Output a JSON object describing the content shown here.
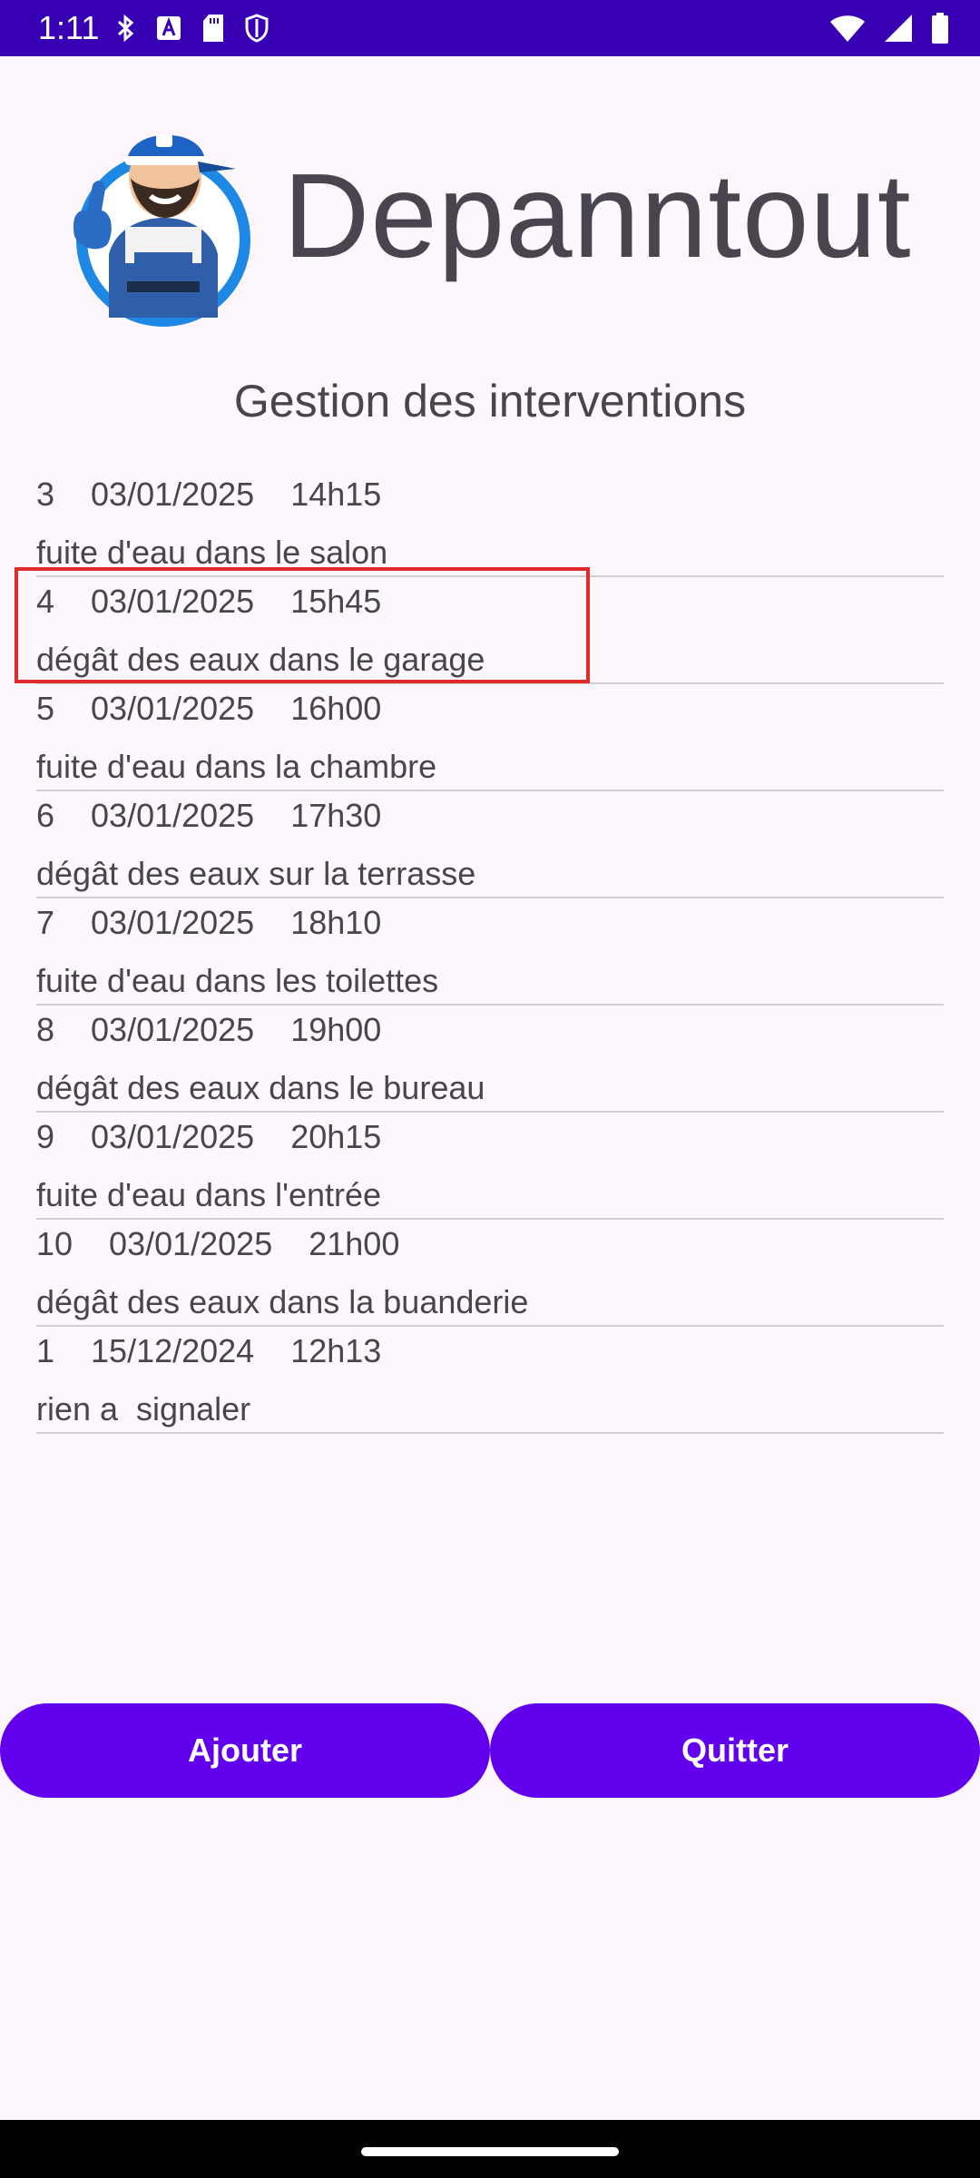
{
  "status_bar": {
    "time": "1:11",
    "icons_left": [
      "bluetooth-icon",
      "a-icon",
      "sd-card-icon",
      "shield-icon"
    ],
    "icons_right": [
      "wifi-icon",
      "signal-icon",
      "battery-icon"
    ]
  },
  "header": {
    "app_title": "Depanntout",
    "subtitle": "Gestion des interventions"
  },
  "interventions": [
    {
      "id": "3",
      "date": "03/01/2025",
      "time": "14h15",
      "description": "fuite d'eau dans le salon"
    },
    {
      "id": "4",
      "date": "03/01/2025",
      "time": "15h45",
      "description": "dégât des eaux dans le garage"
    },
    {
      "id": "5",
      "date": "03/01/2025",
      "time": "16h00",
      "description": "fuite d'eau dans la chambre"
    },
    {
      "id": "6",
      "date": "03/01/2025",
      "time": "17h30",
      "description": "dégât des eaux sur la terrasse"
    },
    {
      "id": "7",
      "date": "03/01/2025",
      "time": "18h10",
      "description": "fuite d'eau dans les toilettes"
    },
    {
      "id": "8",
      "date": "03/01/2025",
      "time": "19h00",
      "description": "dégât des eaux dans le bureau"
    },
    {
      "id": "9",
      "date": "03/01/2025",
      "time": "20h15",
      "description": "fuite d'eau dans l'entrée"
    },
    {
      "id": "10",
      "date": "03/01/2025",
      "time": "21h00",
      "description": "dégât des eaux dans la buanderie"
    },
    {
      "id": "1",
      "date": "15/12/2024",
      "time": "12h13",
      "description": "rien a  signaler"
    }
  ],
  "buttons": {
    "add_label": "Ajouter",
    "quit_label": "Quitter"
  },
  "colors": {
    "status_bar": "#3700b3",
    "primary": "#6200ee",
    "background": "#fdf7fd",
    "text": "#49454f",
    "highlight": "#e02b2b"
  }
}
